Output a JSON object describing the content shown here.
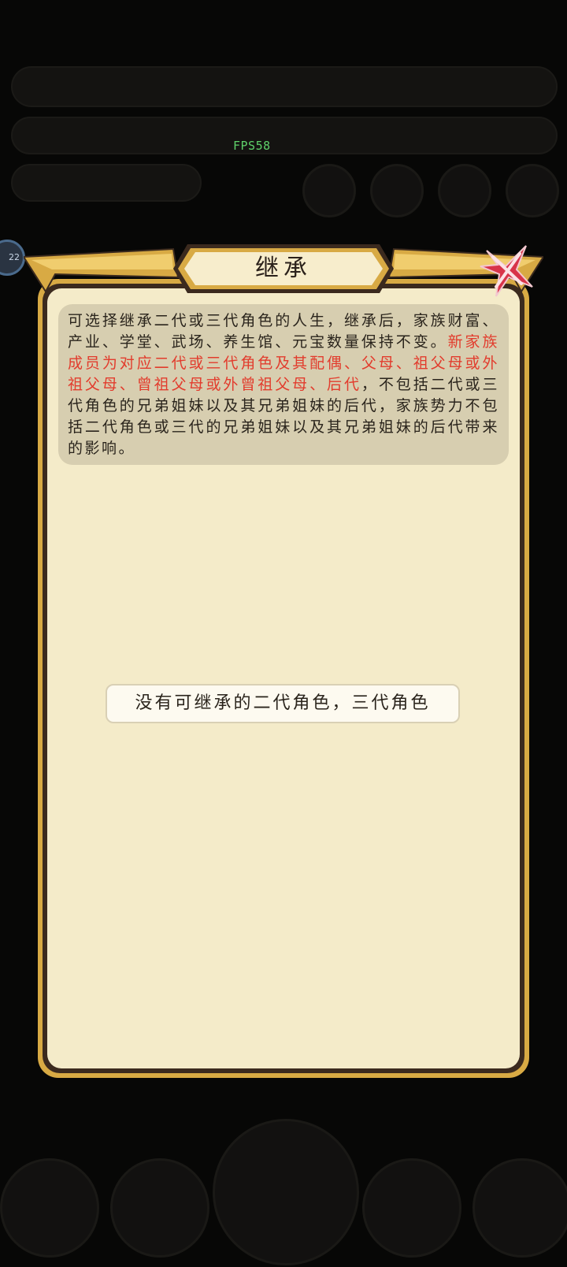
{
  "hud": {
    "fps": "FPS58",
    "side_badge": "22"
  },
  "dialog": {
    "title": "继承",
    "description": {
      "part1": "可选择继承二代或三代角色的人生，继承后，家族财富、产业、学堂、武场、养生馆、元宝数量保持不变。",
      "part2_red": "新家族成员为对应二代或三代角色及其配偶、父母、祖父母或外祖父母、曾祖父母或外曾祖父母、后代",
      "part3": "，不包括二代或三代角色的兄弟姐妹以及其兄弟姐妹的后代，家族势力不包括二代角色或三代的兄弟姐妹以及其兄弟姐妹的后代带来的影响。"
    },
    "empty_message": "没有可继承的二代角色，三代角色"
  },
  "colors": {
    "frame_gold": "#d8aa44",
    "frame_dark": "#3b2a1e",
    "parchment": "#f4ebc9",
    "info_bg": "#d7ceb0",
    "red_text": "#e23c2d",
    "close_red": "#d8344a",
    "fps_green": "#5fd16a"
  },
  "icons": {
    "close": "close-x-icon"
  }
}
